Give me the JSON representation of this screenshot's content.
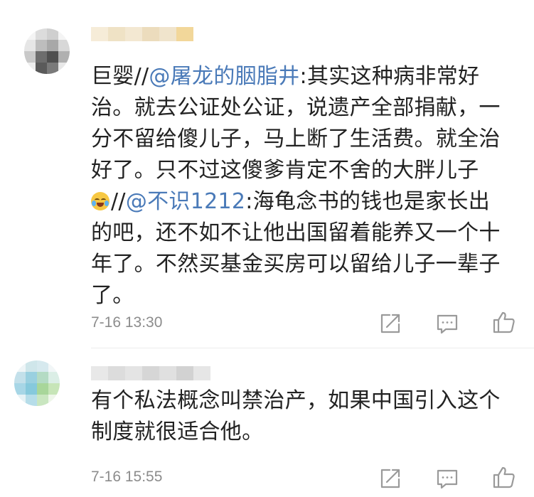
{
  "comments": [
    {
      "lines": [
        {
          "prefix": "巨婴//",
          "mention": "@屠龙的胭脂井",
          "suffix": ":其实这种病非常好"
        },
        {
          "text": "治。就去公证处公证，说遗产全部捐献，一"
        },
        {
          "text": "分不留给傻儿子，马上断了生活费。就全治"
        },
        {
          "text": "好了。只不过这傻爹肯定不舍的大胖儿子"
        },
        {
          "emoji": "laugh-cry-emoji",
          "prefix": "//",
          "mention": "@不识1212",
          "suffix": ":海龟念书的钱也是家长出"
        },
        {
          "text": "的吧，还不如不让他出国留着能养又一个十"
        },
        {
          "text": "年了。不然买基金买房可以留给儿子一辈子"
        },
        {
          "text": "了。"
        }
      ],
      "time": "7-16 13:30"
    },
    {
      "lines": [
        {
          "text": "有个私法概念叫禁治产，如果中国引入这个"
        },
        {
          "text": "制度就很适合他。"
        }
      ],
      "time": "7-16 15:55"
    }
  ],
  "icons": {
    "forward": "forward-icon",
    "comment": "comment-icon",
    "like": "like-icon"
  },
  "colors": {
    "mention": "#4a7ab8",
    "text": "#222222",
    "time": "#8c8c8c",
    "icon": "#9a9a9a"
  }
}
